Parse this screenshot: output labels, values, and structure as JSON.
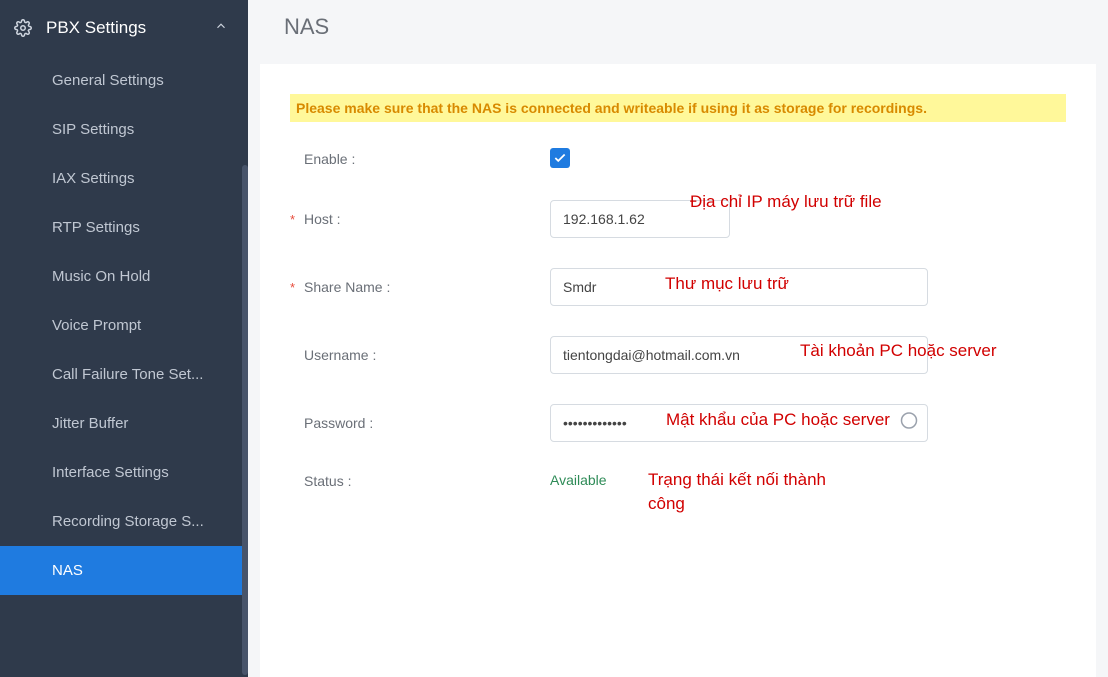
{
  "sidebar": {
    "group_label": "PBX Settings",
    "items": [
      {
        "label": "General Settings"
      },
      {
        "label": "SIP Settings"
      },
      {
        "label": "IAX Settings"
      },
      {
        "label": "RTP Settings"
      },
      {
        "label": "Music On Hold"
      },
      {
        "label": "Voice Prompt"
      },
      {
        "label": "Call Failure Tone Set..."
      },
      {
        "label": "Jitter Buffer"
      },
      {
        "label": "Interface Settings"
      },
      {
        "label": "Recording Storage S..."
      },
      {
        "label": "NAS"
      }
    ],
    "active_index": 10
  },
  "page": {
    "title": "NAS",
    "alert": "Please make sure that the NAS is connected and writeable if using it as storage for recordings."
  },
  "form": {
    "enable": {
      "label": "Enable :",
      "checked": true
    },
    "host": {
      "label": "Host :",
      "required": true,
      "value": "192.168.1.62"
    },
    "share": {
      "label": "Share Name :",
      "required": true,
      "value": "Smdr"
    },
    "user": {
      "label": "Username :",
      "required": false,
      "value": "tientongdai@hotmail.com.vn"
    },
    "pass": {
      "label": "Password :",
      "required": false,
      "value": "•••••••••••••"
    },
    "status": {
      "label": "Status :",
      "value": "Available"
    }
  },
  "annotations": {
    "host": "Địa chỉ IP máy lưu trữ file",
    "share": "Thư mục lưu trữ",
    "user": "Tài khoản PC hoặc server",
    "pass": "Mật khẩu của PC hoặc server",
    "status1": "Trạng thái kết nối thành",
    "status2": "công"
  }
}
